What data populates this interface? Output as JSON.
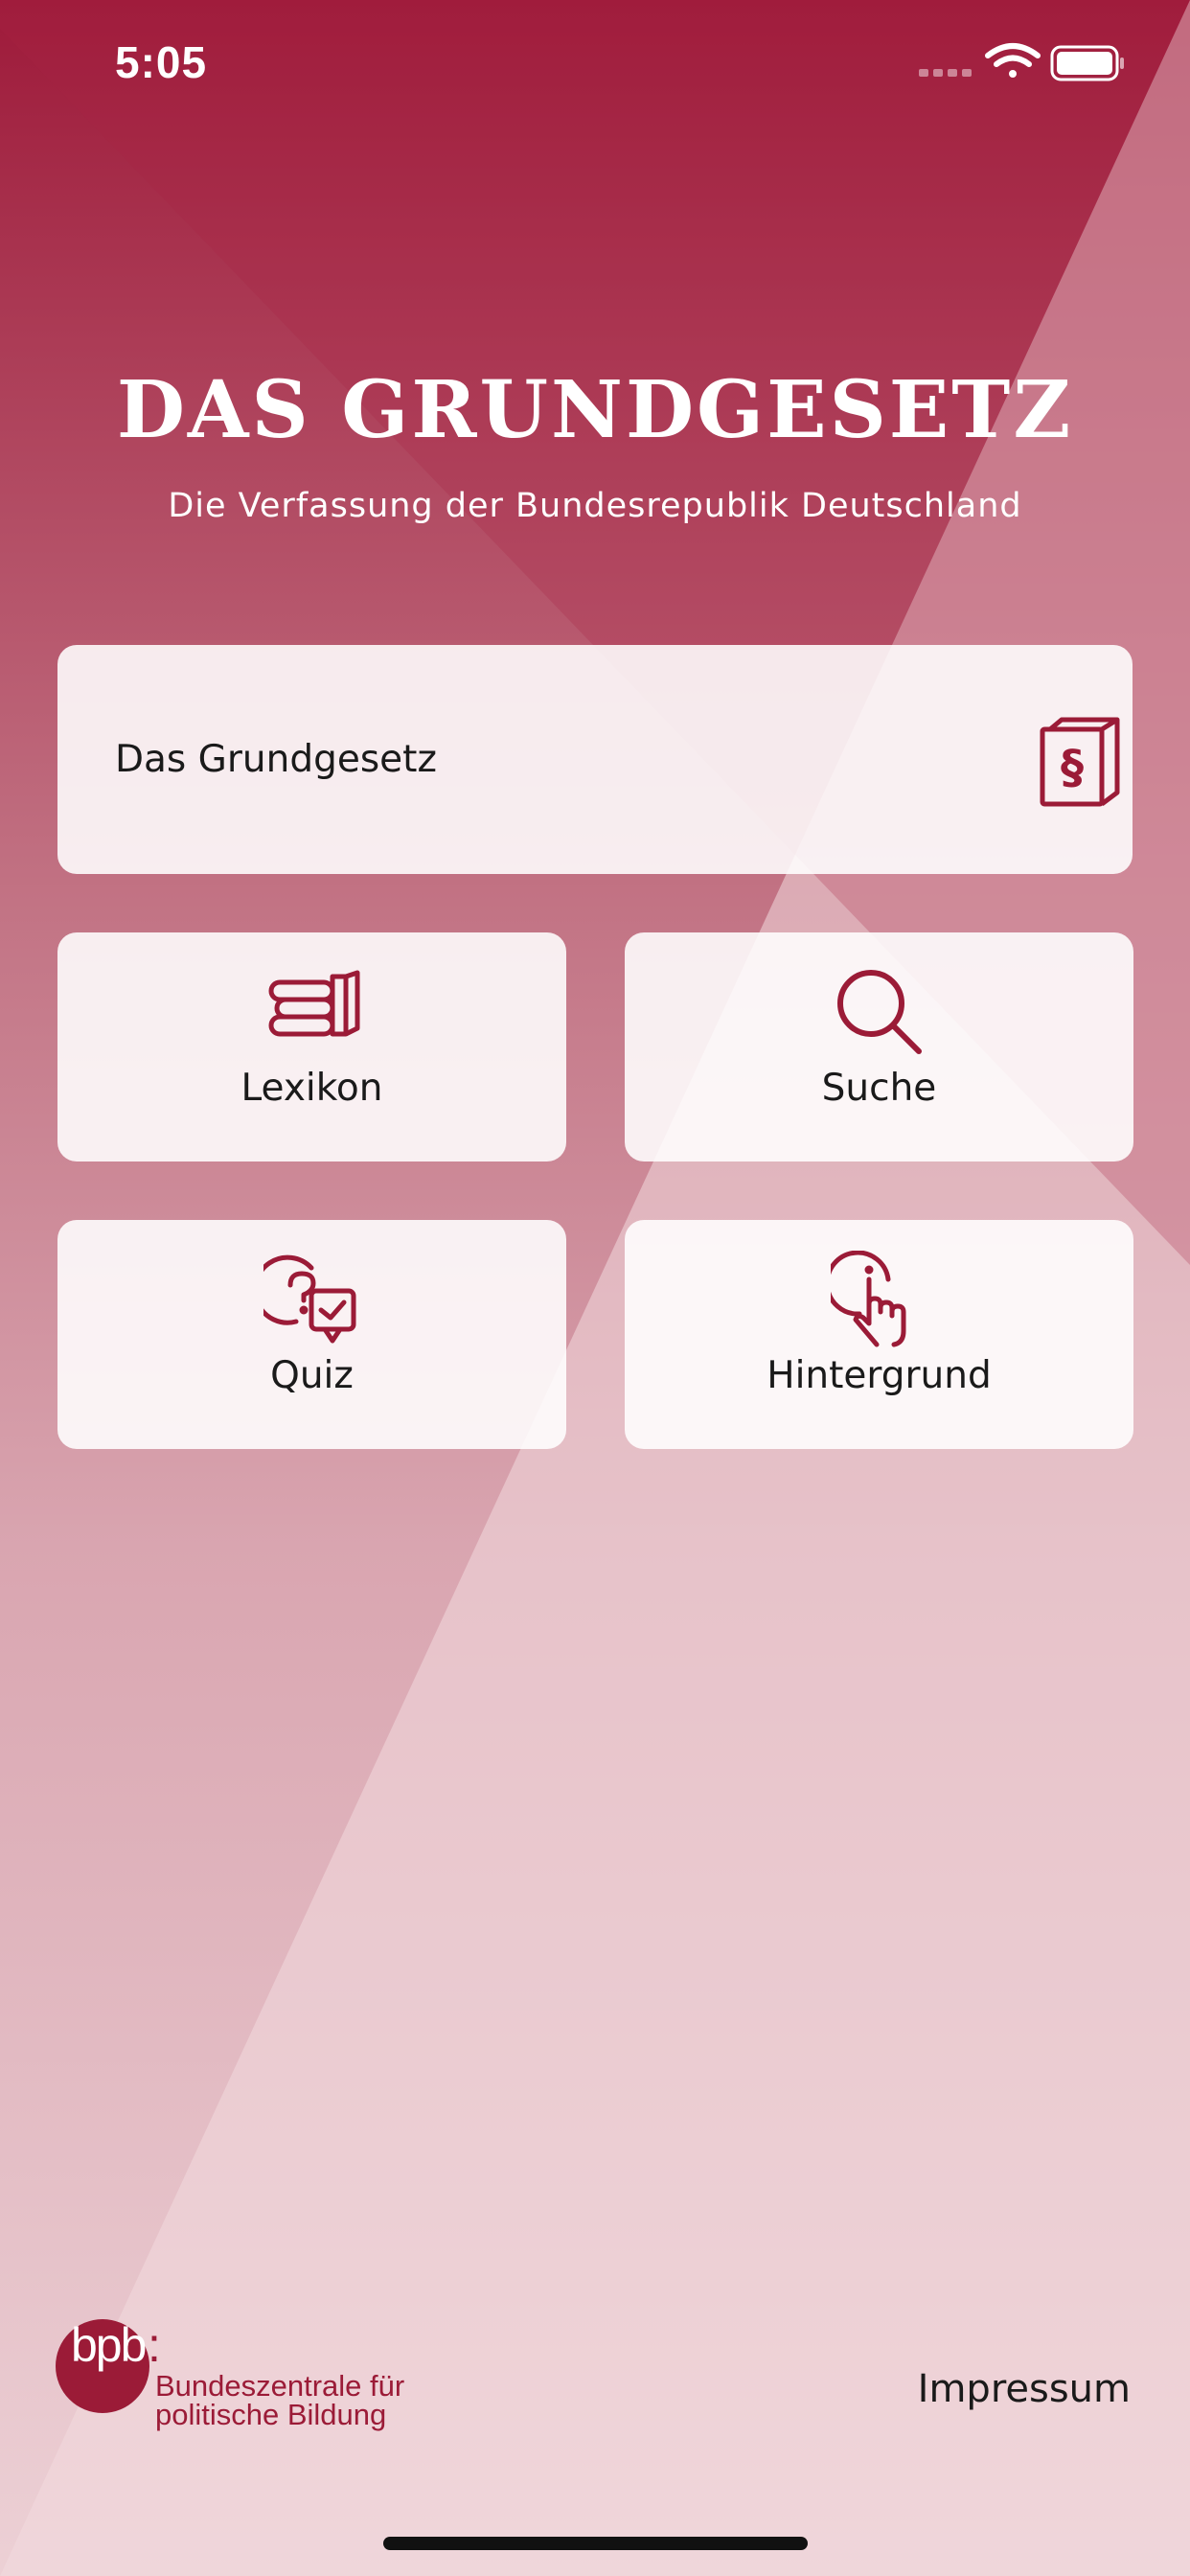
{
  "status_bar": {
    "time": "5:05",
    "icons": [
      "signal-icon",
      "wifi-icon",
      "battery-icon"
    ]
  },
  "header": {
    "title": "DAS GRUNDGESETZ",
    "subtitle": "Die Verfassung der Bundesrepublik Deutschland"
  },
  "menu": {
    "grundgesetz": {
      "label": "Das Grundgesetz",
      "icon": "paragraph-book-icon"
    },
    "lexikon": {
      "label": "Lexikon",
      "icon": "books-icon"
    },
    "suche": {
      "label": "Suche",
      "icon": "search-icon"
    },
    "quiz": {
      "label": "Quiz",
      "icon": "quiz-icon"
    },
    "hintergrund": {
      "label": "Hintergrund",
      "icon": "info-touch-icon"
    }
  },
  "footer": {
    "logo_abbr": "bpb",
    "logo_colon": ":",
    "logo_line1": "Bundeszentrale für",
    "logo_line2": "politische Bildung",
    "impressum": "Impressum"
  },
  "colors": {
    "accent": "#9b1b37",
    "background_light": "#ecd0d5",
    "card": "#ffffff"
  }
}
